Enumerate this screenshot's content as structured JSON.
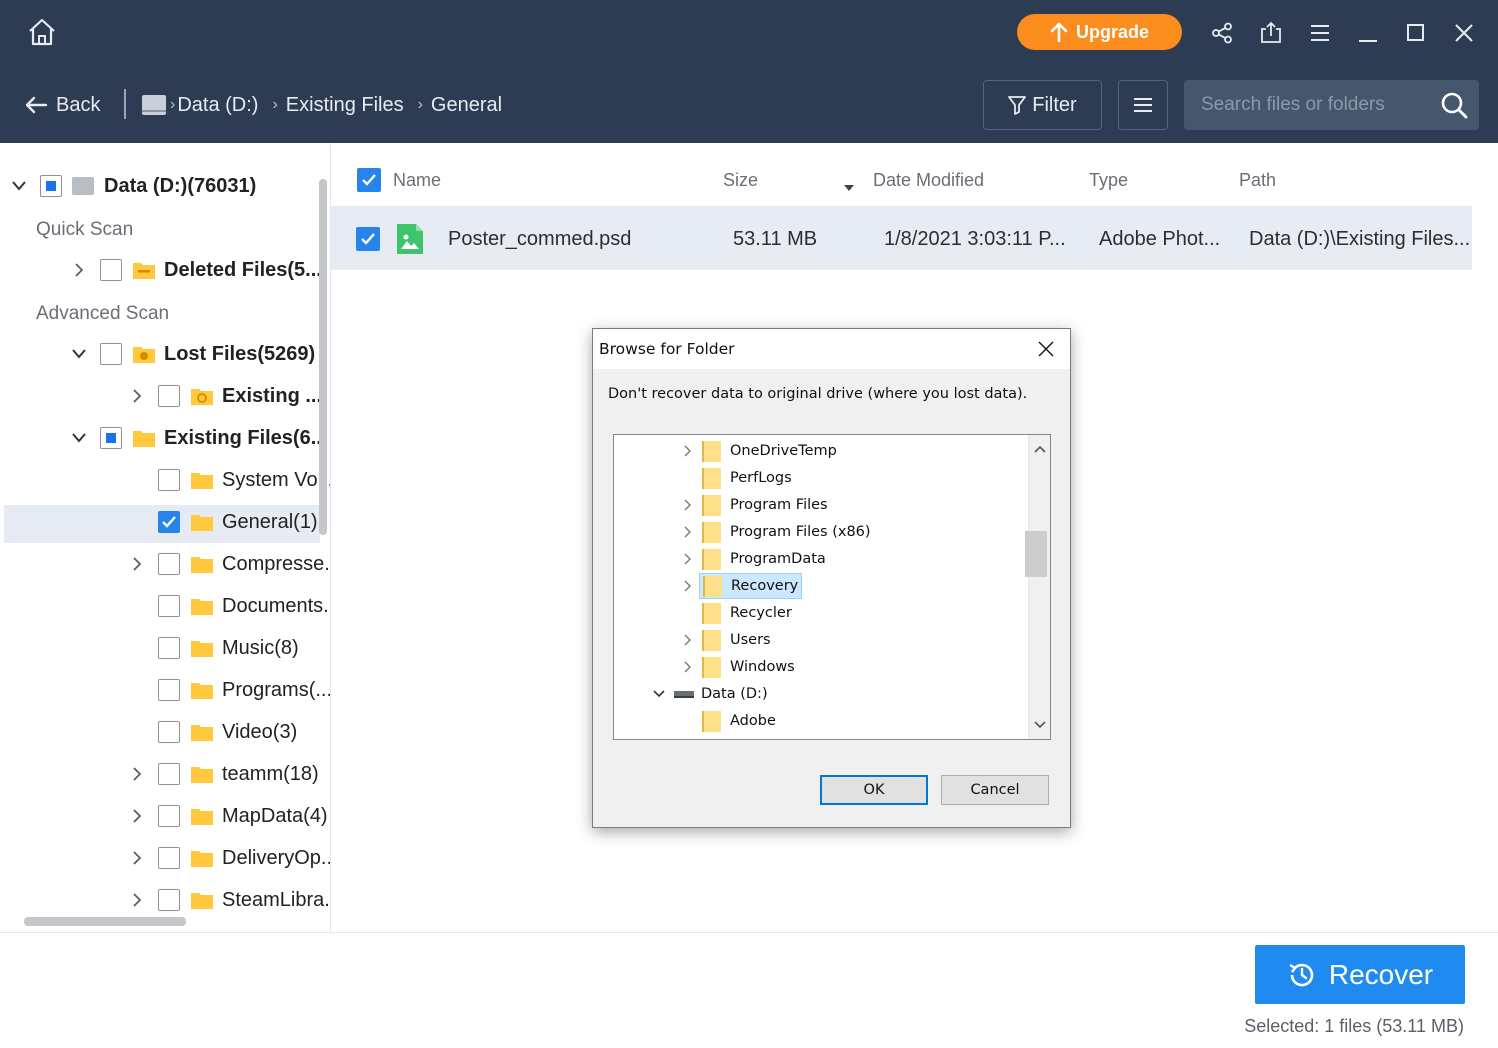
{
  "header": {
    "upgrade_label": "Upgrade",
    "back_label": "Back",
    "breadcrumb": [
      "Data (D:)",
      "Existing Files",
      "General"
    ],
    "filter_label": "Filter",
    "search_placeholder": "Search files or folders"
  },
  "tree": {
    "root_label": "Data (D:)(76031)",
    "quick_scan_label": "Quick Scan",
    "advanced_scan_label": "Advanced Scan",
    "items": [
      {
        "label": "Deleted Files(5..."
      },
      {
        "label": "Lost Files(5269)"
      },
      {
        "label": "Existing ..."
      },
      {
        "label": "Existing Files(6..."
      },
      {
        "label": "System Vol..."
      },
      {
        "label": "General(1)"
      },
      {
        "label": "Compresse..."
      },
      {
        "label": "Documents..."
      },
      {
        "label": "Music(8)"
      },
      {
        "label": "Programs(..."
      },
      {
        "label": "Video(3)"
      },
      {
        "label": "teamm(18)"
      },
      {
        "label": "MapData(4)"
      },
      {
        "label": "DeliveryOp..."
      },
      {
        "label": "SteamLibra..."
      }
    ]
  },
  "table": {
    "columns": [
      "Name",
      "Size",
      "Date Modified",
      "Type",
      "Path"
    ],
    "rows": [
      {
        "name": "Poster_commed.psd",
        "size": "53.11 MB",
        "date": "1/8/2021 3:03:11 P...",
        "type": "Adobe Phot...",
        "path": "Data (D:)\\Existing Files..."
      }
    ]
  },
  "footer": {
    "recover_label": "Recover",
    "selected_text": "Selected: 1 files (53.11 MB)"
  },
  "dialog": {
    "title": "Browse for Folder",
    "message": "Don't recover data to original drive (where you lost data).",
    "folders": [
      {
        "label": "OneDriveTemp"
      },
      {
        "label": "PerfLogs"
      },
      {
        "label": "Program Files"
      },
      {
        "label": "Program Files (x86)"
      },
      {
        "label": "ProgramData"
      },
      {
        "label": "Recovery"
      },
      {
        "label": "Recycler"
      },
      {
        "label": "Users"
      },
      {
        "label": "Windows"
      },
      {
        "label": "Data (D:)"
      },
      {
        "label": "Adobe"
      }
    ],
    "ok_label": "OK",
    "cancel_label": "Cancel"
  },
  "colors": {
    "header_bg": "#2d3c52",
    "accent_blue": "#1f8bf0",
    "upgrade_orange": "#fb8c1e",
    "folder_yellow": "#ffc83d"
  },
  "icons": [
    "home-icon",
    "arrow-up-icon",
    "share-icon",
    "export-icon",
    "menu-icon",
    "minimize-icon",
    "maximize-icon",
    "close-icon",
    "back-arrow-icon",
    "drive-icon",
    "filter-icon",
    "list-icon",
    "search-icon",
    "folder-icon",
    "image-file-icon",
    "recover-icon",
    "chevron-right-icon",
    "chevron-down-icon"
  ]
}
